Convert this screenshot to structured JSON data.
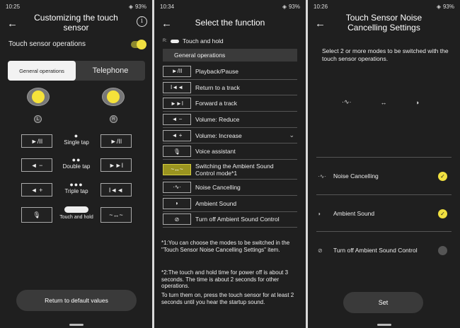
{
  "screen1": {
    "status": {
      "time": "10:25",
      "battery": "93%"
    },
    "title_line1": "Customizing the touch",
    "title_line2": "sensor",
    "touch_sensor_label": "Touch sensor operations",
    "tabs": {
      "general": "General operations",
      "telephone": "Telephone"
    },
    "left_badge": "L",
    "right_badge": "R",
    "controls": {
      "play_pause": "►/II",
      "volume_reduce": "◄ −",
      "volume_increase": "◄ +",
      "next": "►►I",
      "previous": "I◄◄"
    },
    "gestures": {
      "single": "Single tap",
      "double": "Double tap",
      "triple": "Triple tap",
      "hold": "Touch and hold"
    },
    "default_button": "Return to default values"
  },
  "screen2": {
    "status": {
      "time": "10:34",
      "battery": "93%"
    },
    "title": "Select the function",
    "r_key": "R:",
    "r_text": "Touch and hold",
    "section": "General operations",
    "functions": [
      {
        "icon": "►/II",
        "label": "Playback/Pause"
      },
      {
        "icon": "I◄◄",
        "label": "Return to a track"
      },
      {
        "icon": "►►I",
        "label": "Forward a track"
      },
      {
        "icon": "◄ −",
        "label": "Volume: Reduce"
      },
      {
        "icon": "◄ +",
        "label": "Volume: Increase"
      },
      {
        "icon": "🎙",
        "label": "Voice assistant"
      },
      {
        "icon": "~↔~",
        "label_line1": "Switching the Ambient Sound",
        "label_line2": "Control mode*1"
      },
      {
        "icon": "·∿·",
        "label": "Noise Cancelling"
      },
      {
        "icon": "◗",
        "label": "Ambient Sound"
      },
      {
        "icon": "⊘",
        "label": "Turn off Ambient Sound Control"
      }
    ],
    "note1": "*1:You can choose the modes to be switched in the \"Touch Sensor Noise Cancelling Settings\" item.",
    "note2": "*2:The touch and hold time for power off is about 3 seconds. The time is about 2 seconds for other operations.",
    "note3": "To turn them on, press the touch sensor for at least 2 seconds until you hear the startup sound."
  },
  "screen3": {
    "status": {
      "time": "10:26",
      "battery": "93%"
    },
    "title_line1": "Touch Sensor Noise",
    "title_line2": "Cancelling Settings",
    "description": "Select 2 or more modes to be switched with the touch sensor operations.",
    "modes": [
      {
        "label": "Noise Cancelling",
        "checked": true
      },
      {
        "label": "Ambient Sound",
        "checked": true
      },
      {
        "label": "Turn off Ambient Sound Control",
        "checked": false
      }
    ],
    "set_button": "Set"
  },
  "colors": {
    "accent": "#f0e040",
    "background": "#1f1f1f",
    "panel": "#3a3a3a"
  }
}
